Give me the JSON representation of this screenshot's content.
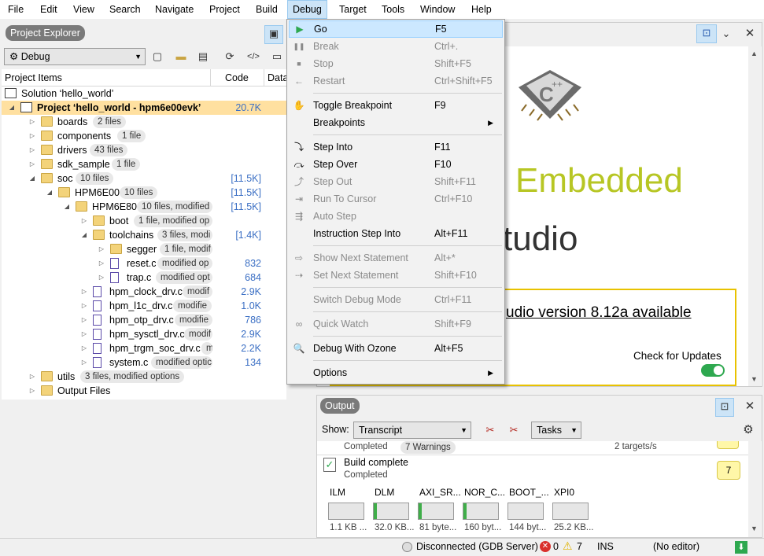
{
  "menubar": [
    "File",
    "Edit",
    "View",
    "Search",
    "Navigate",
    "Project",
    "Build",
    "Debug",
    "Target",
    "Tools",
    "Window",
    "Help"
  ],
  "project_explorer": {
    "title": "Project Explorer",
    "config": "Debug",
    "columns": [
      "Project Items",
      "Code",
      "Data"
    ],
    "tree": [
      {
        "label": "Solution ‘hello_world’",
        "badge": "",
        "code": ""
      },
      {
        "label": "Project ‘hello_world - hpm6e00evk’",
        "badge": "",
        "code": "20.7K"
      },
      {
        "label": "boards",
        "badge": "2 files",
        "code": ""
      },
      {
        "label": "components",
        "badge": "1 file",
        "code": ""
      },
      {
        "label": "drivers",
        "badge": "43 files",
        "code": ""
      },
      {
        "label": "sdk_sample",
        "badge": "1 file",
        "code": ""
      },
      {
        "label": "soc",
        "badge": "10 files",
        "code": "[11.5K]"
      },
      {
        "label": "HPM6E00",
        "badge": "10 files",
        "code": "[11.5K]"
      },
      {
        "label": "HPM6E80",
        "badge": "10 files, modified",
        "code": "[11.5K]"
      },
      {
        "label": "boot",
        "badge": "1 file, modified op",
        "code": ""
      },
      {
        "label": "toolchains",
        "badge": "3 files, modi",
        "code": "[1.4K]"
      },
      {
        "label": "segger",
        "badge": "1 file, modif",
        "code": ""
      },
      {
        "label": "reset.c",
        "badge": "modified op",
        "code": "832"
      },
      {
        "label": "trap.c",
        "badge": "modified opt",
        "code": "684"
      },
      {
        "label": "hpm_clock_drv.c",
        "badge": "modif",
        "code": "2.9K"
      },
      {
        "label": "hpm_l1c_drv.c",
        "badge": "modifie",
        "code": "1.0K"
      },
      {
        "label": "hpm_otp_drv.c",
        "badge": "modifie",
        "code": "786"
      },
      {
        "label": "hpm_sysctl_drv.c",
        "badge": "modif",
        "code": "2.9K"
      },
      {
        "label": "hpm_trgm_soc_drv.c",
        "badge": "m",
        "code": "2.2K"
      },
      {
        "label": "system.c",
        "badge": "modified optic",
        "code": "134"
      },
      {
        "label": "utils",
        "badge": "3 files, modified options",
        "code": ""
      },
      {
        "label": "Output Files",
        "badge": "",
        "code": ""
      }
    ]
  },
  "welcome": {
    "embedded": "Embedded",
    "studio": "tudio",
    "update_text": "udio version 8.12a available",
    "check_updates": "Check for Updates",
    "toggle_on": true
  },
  "output": {
    "title": "Output",
    "show_label": "Show:",
    "show_value": "Transcript",
    "tasks": "Tasks",
    "row1_status": "Completed",
    "row1_warnings": "7 Warnings",
    "row1_targets": "2 targets/s",
    "row2_title": "Build complete",
    "row2_status": "Completed",
    "row2_count": "7",
    "memory": [
      {
        "name": "ILM",
        "size": "1.1 KB ...",
        "fill": 0.0
      },
      {
        "name": "DLM",
        "size": "32.0 KB...",
        "fill": 0.05
      },
      {
        "name": "AXI_SR...",
        "size": "81 byte...",
        "fill": 0.05
      },
      {
        "name": "NOR_C...",
        "size": "160 byt...",
        "fill": 0.05
      },
      {
        "name": "BOOT_...",
        "size": "144 byt...",
        "fill": 0.0
      },
      {
        "name": "XPI0",
        "size": "25.2 KB...",
        "fill": 0.0
      }
    ]
  },
  "status": {
    "connection": "Disconnected (GDB Server)",
    "errors": "0",
    "warnings": "7",
    "mode": "INS",
    "editor": "(No editor)"
  },
  "debug_menu": [
    {
      "label": "Go",
      "shortcut": "F5",
      "icon": "play-icon",
      "enabled": true,
      "highlight": true
    },
    {
      "label": "Break",
      "shortcut": "Ctrl+.",
      "icon": "pause-icon",
      "enabled": false
    },
    {
      "label": "Stop",
      "shortcut": "Shift+F5",
      "icon": "stop-icon",
      "enabled": false
    },
    {
      "label": "Restart",
      "shortcut": "Ctrl+Shift+F5",
      "icon": "restart-icon",
      "enabled": false
    },
    {
      "sep": true
    },
    {
      "label": "Toggle Breakpoint",
      "shortcut": "F9",
      "icon": "hand-icon",
      "enabled": true
    },
    {
      "label": "Breakpoints",
      "shortcut": "",
      "icon": "",
      "enabled": true,
      "submenu": true
    },
    {
      "sep": true
    },
    {
      "label": "Step Into",
      "shortcut": "F11",
      "icon": "step-into-icon",
      "enabled": true
    },
    {
      "label": "Step Over",
      "shortcut": "F10",
      "icon": "step-over-icon",
      "enabled": true
    },
    {
      "label": "Step Out",
      "shortcut": "Shift+F11",
      "icon": "step-out-icon",
      "enabled": false
    },
    {
      "label": "Run To Cursor",
      "shortcut": "Ctrl+F10",
      "icon": "run-to-cursor-icon",
      "enabled": false
    },
    {
      "label": "Auto Step",
      "shortcut": "",
      "icon": "auto-step-icon",
      "enabled": false
    },
    {
      "label": "Instruction Step Into",
      "shortcut": "Alt+F11",
      "icon": "",
      "enabled": true
    },
    {
      "sep": true
    },
    {
      "label": "Show Next Statement",
      "shortcut": "Alt+*",
      "icon": "show-next-icon",
      "enabled": false
    },
    {
      "label": "Set Next Statement",
      "shortcut": "Shift+F10",
      "icon": "set-next-icon",
      "enabled": false
    },
    {
      "sep": true
    },
    {
      "label": "Switch Debug Mode",
      "shortcut": "Ctrl+F11",
      "icon": "",
      "enabled": false
    },
    {
      "sep": true
    },
    {
      "label": "Quick Watch",
      "shortcut": "Shift+F9",
      "icon": "glasses-icon",
      "enabled": false
    },
    {
      "sep": true
    },
    {
      "label": "Debug With Ozone",
      "shortcut": "Alt+F5",
      "icon": "magnifier-icon",
      "enabled": true
    },
    {
      "sep": true
    },
    {
      "label": "Options",
      "shortcut": "",
      "icon": "",
      "enabled": true,
      "submenu": true
    }
  ]
}
